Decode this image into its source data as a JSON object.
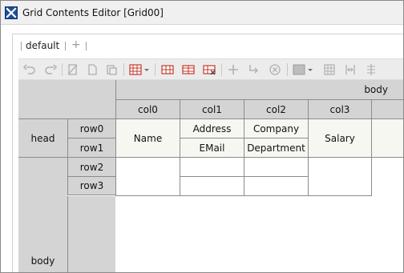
{
  "window": {
    "title": "Grid Contents Editor [Grid00]"
  },
  "tabs": [
    {
      "label": "default"
    },
    {
      "label": "+"
    }
  ],
  "toolbar": {
    "buttons": [
      {
        "icon": "undo-icon"
      },
      {
        "icon": "redo-icon"
      },
      {
        "icon": "cut-icon"
      },
      {
        "icon": "copy-icon"
      },
      {
        "icon": "paste-icon"
      },
      {
        "icon": "column-menu-icon"
      },
      {
        "icon": "insert-column-icon"
      },
      {
        "icon": "insert-row-icon"
      },
      {
        "icon": "delete-cells-icon"
      },
      {
        "icon": "add-icon"
      },
      {
        "icon": "move-icon"
      },
      {
        "icon": "remove-icon"
      },
      {
        "icon": "format-menu-icon"
      },
      {
        "icon": "table-icon"
      },
      {
        "icon": "split-icon"
      },
      {
        "icon": "align-icon"
      }
    ]
  },
  "grid": {
    "band_body": "body",
    "columns": [
      "col0",
      "col1",
      "col2",
      "col3"
    ],
    "head_band": "head",
    "head_rows": [
      "row0",
      "row1"
    ],
    "body_band": "body",
    "body_rows": [
      "row2",
      "row3"
    ],
    "head_cells": {
      "name": "Name",
      "address": "Address",
      "email": "EMail",
      "company": "Company",
      "department": "Department",
      "salary": "Salary"
    }
  }
}
